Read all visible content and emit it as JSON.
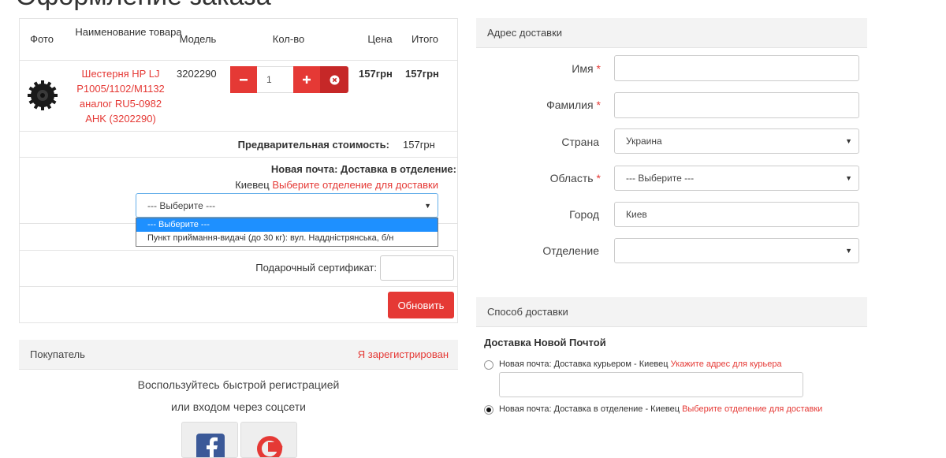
{
  "page_title": "Оформление заказа",
  "cart": {
    "headers": {
      "photo": "Фото",
      "name": "Наименование товара",
      "model": "Модель",
      "qty": "Кол-во",
      "price": "Цена",
      "total": "Итого"
    },
    "item": {
      "name_lines": [
        "Шестерня HP LJ",
        "P1005/1102/M1132",
        "аналог RU5-0982",
        "AHK (3202290)"
      ],
      "model": "3202290",
      "qty": "1",
      "price": "157грн",
      "total": "157грн"
    },
    "subtotal_label": "Предварительная стоимость:",
    "subtotal_value": "157грн",
    "shipping_title": "Новая почта: Доставка в отделение:",
    "shipping_city": "Киевец",
    "shipping_link": "Выберите отделение для доставки",
    "branch_select": {
      "selected": "--- Выберите ---",
      "options": [
        "--- Выберите ---",
        "Пункт приймання-видачі (до 30 кг): вул. Наддністрянська, б/н"
      ]
    },
    "gift_label": "Подарочный сертификат:",
    "update_button": "Обновить"
  },
  "buyer": {
    "title": "Покупатель",
    "registered_link": "Я зарегистрирован",
    "text1": "Воспользуйтесь быстрой регистрацией",
    "text2": "или входом через соцсети"
  },
  "address": {
    "title": "Адрес доставки",
    "fields": {
      "first_name": "Имя",
      "last_name": "Фамилия",
      "country": "Страна",
      "region": "Область",
      "city": "Город",
      "branch": "Отделение"
    },
    "country_value": "Украина",
    "region_value": "--- Выберите ---",
    "city_value": "Киев",
    "required_mark": "*"
  },
  "delivery": {
    "title": "Способ доставки",
    "subtitle": "Доставка Новой Почтой",
    "option1_text": "Новая почта: Доставка курьером - Киевец",
    "option1_link": "Укажите адрес для курьера",
    "option2_text": "Новая почта: Доставка в отделение - Киевец",
    "option2_link": "Выберите отделение для доставки"
  },
  "colors": {
    "accent": "#e53935",
    "select_highlight": "#1e90ff"
  },
  "icons": [
    "minus-icon",
    "plus-icon",
    "remove-icon",
    "caret-down-icon",
    "facebook-icon",
    "google-icon"
  ]
}
